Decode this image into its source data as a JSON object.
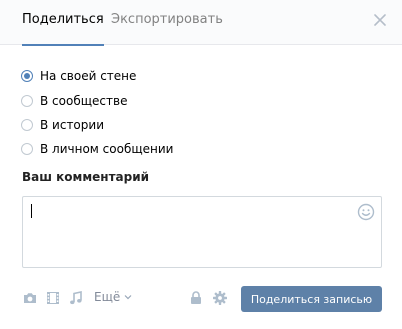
{
  "tabs": [
    {
      "label": "Поделиться",
      "active": true
    },
    {
      "label": "Экспортировать",
      "active": false
    }
  ],
  "share_options": [
    {
      "label": "На своей стене",
      "checked": true
    },
    {
      "label": "В сообществе",
      "checked": false
    },
    {
      "label": "В истории",
      "checked": false
    },
    {
      "label": "В личном сообщении",
      "checked": false
    }
  ],
  "comment": {
    "label": "Ваш комментарий",
    "value": ""
  },
  "footer": {
    "more_label": "Ещё",
    "submit_label": "Поделиться записью",
    "icons": [
      "camera-icon",
      "video-icon",
      "music-icon",
      "lock-icon",
      "gear-icon"
    ]
  },
  "colors": {
    "accent": "#5181b8",
    "button": "#5e81a8",
    "icon": "#aebdcc",
    "tab_bar": "#fafbfc"
  }
}
